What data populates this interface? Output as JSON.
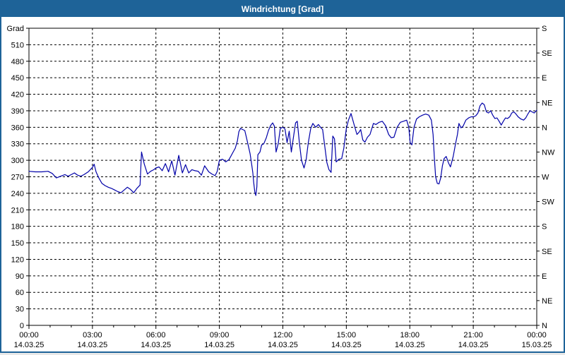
{
  "window": {
    "title": "Windrichtung [Grad]"
  },
  "colors": {
    "titlebar": "#1e6398",
    "frame": "#1e6398",
    "line": "#0000a8",
    "grid": "#000000",
    "plot_background": "#ffffff",
    "text": "#000000"
  },
  "chart_data": {
    "type": "line",
    "title": "Windrichtung [Grad]",
    "ylabel_left": "Grad",
    "grid": "dashed",
    "y_axis": {
      "min": 0,
      "max": 540,
      "tick_step": 30,
      "tick_labels": [
        "0",
        "30",
        "60",
        "90",
        "120",
        "150",
        "180",
        "210",
        "240",
        "270",
        "300",
        "330",
        "360",
        "390",
        "420",
        "450",
        "480",
        "510"
      ]
    },
    "y_axis_right": {
      "labels": [
        {
          "grad": 540,
          "label": "S"
        },
        {
          "grad": 495,
          "label": "SE"
        },
        {
          "grad": 450,
          "label": "E"
        },
        {
          "grad": 405,
          "label": "NE"
        },
        {
          "grad": 360,
          "label": "N"
        },
        {
          "grad": 315,
          "label": "NW"
        },
        {
          "grad": 270,
          "label": "W"
        },
        {
          "grad": 225,
          "label": "SW"
        },
        {
          "grad": 180,
          "label": "S"
        },
        {
          "grad": 135,
          "label": "SE"
        },
        {
          "grad": 90,
          "label": "E"
        },
        {
          "grad": 45,
          "label": "NE"
        },
        {
          "grad": 0,
          "label": "N"
        }
      ]
    },
    "x_axis": {
      "min_hours": 0,
      "max_hours": 24,
      "major_step_hours": 3,
      "minor_step_hours": 1,
      "ticks": [
        {
          "hour": 0,
          "time": "00:00",
          "date": "14.03.25"
        },
        {
          "hour": 3,
          "time": "03:00",
          "date": "14.03.25"
        },
        {
          "hour": 6,
          "time": "06:00",
          "date": "14.03.25"
        },
        {
          "hour": 9,
          "time": "09:00",
          "date": "14.03.25"
        },
        {
          "hour": 12,
          "time": "12:00",
          "date": "14.03.25"
        },
        {
          "hour": 15,
          "time": "15:00",
          "date": "14.03.25"
        },
        {
          "hour": 18,
          "time": "18:00",
          "date": "14.03.25"
        },
        {
          "hour": 21,
          "time": "21:00",
          "date": "14.03.25"
        },
        {
          "hour": 24,
          "time": "00:00",
          "date": "15.03.25"
        }
      ]
    },
    "series": [
      {
        "name": "Windrichtung",
        "color": "#0000a8",
        "points": [
          [
            0.0,
            280
          ],
          [
            0.3,
            279
          ],
          [
            0.6,
            279
          ],
          [
            0.9,
            280
          ],
          [
            1.1,
            276
          ],
          [
            1.3,
            268
          ],
          [
            1.5,
            271
          ],
          [
            1.7,
            274
          ],
          [
            1.85,
            271
          ],
          [
            2.0,
            274
          ],
          [
            2.15,
            277
          ],
          [
            2.3,
            273
          ],
          [
            2.45,
            271
          ],
          [
            2.6,
            274
          ],
          [
            2.8,
            279
          ],
          [
            3.0,
            287
          ],
          [
            3.08,
            293
          ],
          [
            3.17,
            279
          ],
          [
            3.3,
            268
          ],
          [
            3.45,
            258
          ],
          [
            3.6,
            254
          ],
          [
            3.75,
            251
          ],
          [
            3.9,
            249
          ],
          [
            4.05,
            246
          ],
          [
            4.2,
            243
          ],
          [
            4.35,
            241
          ],
          [
            4.5,
            246
          ],
          [
            4.65,
            251
          ],
          [
            4.8,
            247
          ],
          [
            4.95,
            241
          ],
          [
            5.1,
            249
          ],
          [
            5.25,
            255
          ],
          [
            5.32,
            315
          ],
          [
            5.45,
            293
          ],
          [
            5.6,
            275
          ],
          [
            5.75,
            280
          ],
          [
            5.9,
            283
          ],
          [
            6.0,
            286
          ],
          [
            6.15,
            288
          ],
          [
            6.3,
            281
          ],
          [
            6.45,
            294
          ],
          [
            6.6,
            279
          ],
          [
            6.75,
            299
          ],
          [
            6.9,
            273
          ],
          [
            7.08,
            309
          ],
          [
            7.25,
            277
          ],
          [
            7.4,
            292
          ],
          [
            7.55,
            277
          ],
          [
            7.7,
            283
          ],
          [
            7.85,
            281
          ],
          [
            8.0,
            280
          ],
          [
            8.15,
            273
          ],
          [
            8.3,
            290
          ],
          [
            8.5,
            279
          ],
          [
            8.65,
            275
          ],
          [
            8.8,
            272
          ],
          [
            8.9,
            280
          ],
          [
            9.0,
            300
          ],
          [
            9.15,
            302
          ],
          [
            9.3,
            297
          ],
          [
            9.45,
            301
          ],
          [
            9.55,
            308
          ],
          [
            9.65,
            315
          ],
          [
            9.75,
            322
          ],
          [
            9.85,
            335
          ],
          [
            9.92,
            352
          ],
          [
            10.0,
            358
          ],
          [
            10.1,
            356
          ],
          [
            10.2,
            354
          ],
          [
            10.28,
            341
          ],
          [
            10.38,
            324
          ],
          [
            10.45,
            312
          ],
          [
            10.52,
            294
          ],
          [
            10.58,
            277
          ],
          [
            10.62,
            260
          ],
          [
            10.67,
            243
          ],
          [
            10.72,
            236
          ],
          [
            10.77,
            252
          ],
          [
            10.82,
            310
          ],
          [
            10.92,
            315
          ],
          [
            11.0,
            328
          ],
          [
            11.1,
            330
          ],
          [
            11.22,
            341
          ],
          [
            11.32,
            354
          ],
          [
            11.42,
            363
          ],
          [
            11.52,
            368
          ],
          [
            11.6,
            362
          ],
          [
            11.68,
            315
          ],
          [
            11.78,
            330
          ],
          [
            11.88,
            358
          ],
          [
            12.0,
            360
          ],
          [
            12.1,
            357
          ],
          [
            12.2,
            332
          ],
          [
            12.3,
            353
          ],
          [
            12.4,
            315
          ],
          [
            12.5,
            342
          ],
          [
            12.6,
            368
          ],
          [
            12.68,
            371
          ],
          [
            12.78,
            332
          ],
          [
            12.88,
            300
          ],
          [
            13.0,
            286
          ],
          [
            13.1,
            301
          ],
          [
            13.2,
            331
          ],
          [
            13.32,
            358
          ],
          [
            13.42,
            367
          ],
          [
            13.55,
            360
          ],
          [
            13.68,
            365
          ],
          [
            13.78,
            360
          ],
          [
            13.88,
            356
          ],
          [
            13.98,
            326
          ],
          [
            14.08,
            296
          ],
          [
            14.18,
            283
          ],
          [
            14.28,
            278
          ],
          [
            14.36,
            344
          ],
          [
            14.44,
            339
          ],
          [
            14.52,
            297
          ],
          [
            14.65,
            302
          ],
          [
            14.78,
            303
          ],
          [
            14.88,
            322
          ],
          [
            15.0,
            358
          ],
          [
            15.1,
            373
          ],
          [
            15.22,
            385
          ],
          [
            15.35,
            367
          ],
          [
            15.5,
            347
          ],
          [
            15.6,
            351
          ],
          [
            15.68,
            356
          ],
          [
            15.78,
            337
          ],
          [
            15.88,
            333
          ],
          [
            16.0,
            342
          ],
          [
            16.12,
            347
          ],
          [
            16.28,
            367
          ],
          [
            16.4,
            365
          ],
          [
            16.55,
            369
          ],
          [
            16.7,
            371
          ],
          [
            16.85,
            363
          ],
          [
            17.0,
            347
          ],
          [
            17.12,
            341
          ],
          [
            17.25,
            342
          ],
          [
            17.4,
            360
          ],
          [
            17.55,
            369
          ],
          [
            17.7,
            371
          ],
          [
            17.85,
            373
          ],
          [
            17.95,
            360
          ],
          [
            18.02,
            332
          ],
          [
            18.1,
            328
          ],
          [
            18.2,
            360
          ],
          [
            18.32,
            375
          ],
          [
            18.45,
            379
          ],
          [
            18.6,
            382
          ],
          [
            18.75,
            384
          ],
          [
            18.9,
            382
          ],
          [
            19.02,
            373
          ],
          [
            19.1,
            347
          ],
          [
            19.16,
            305
          ],
          [
            19.22,
            270
          ],
          [
            19.3,
            258
          ],
          [
            19.38,
            257
          ],
          [
            19.46,
            268
          ],
          [
            19.54,
            290
          ],
          [
            19.62,
            303
          ],
          [
            19.72,
            307
          ],
          [
            19.82,
            296
          ],
          [
            19.92,
            288
          ],
          [
            20.05,
            307
          ],
          [
            20.15,
            328
          ],
          [
            20.25,
            347
          ],
          [
            20.32,
            367
          ],
          [
            20.42,
            359
          ],
          [
            20.52,
            362
          ],
          [
            20.65,
            373
          ],
          [
            20.78,
            377
          ],
          [
            20.9,
            379
          ],
          [
            21.02,
            379
          ],
          [
            21.12,
            381
          ],
          [
            21.22,
            386
          ],
          [
            21.32,
            399
          ],
          [
            21.42,
            404
          ],
          [
            21.52,
            401
          ],
          [
            21.62,
            388
          ],
          [
            21.72,
            386
          ],
          [
            21.82,
            390
          ],
          [
            21.92,
            382
          ],
          [
            22.02,
            376
          ],
          [
            22.12,
            377
          ],
          [
            22.22,
            371
          ],
          [
            22.32,
            364
          ],
          [
            22.42,
            371
          ],
          [
            22.52,
            377
          ],
          [
            22.62,
            376
          ],
          [
            22.72,
            379
          ],
          [
            22.82,
            386
          ],
          [
            22.92,
            388
          ],
          [
            23.02,
            384
          ],
          [
            23.12,
            379
          ],
          [
            23.25,
            375
          ],
          [
            23.38,
            373
          ],
          [
            23.48,
            377
          ],
          [
            23.58,
            384
          ],
          [
            23.68,
            390
          ],
          [
            23.78,
            388
          ],
          [
            23.88,
            386
          ],
          [
            24.0,
            391
          ]
        ]
      }
    ]
  }
}
